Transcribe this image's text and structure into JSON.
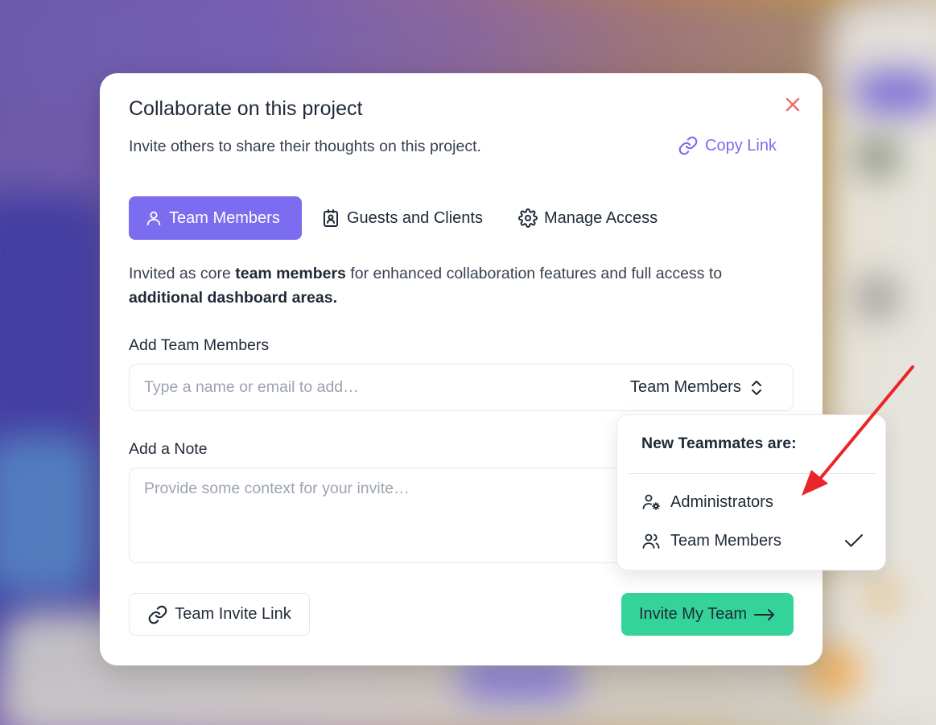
{
  "modal": {
    "title": "Collaborate on this project",
    "subtitle": "Invite others to share their thoughts on this project.",
    "copy_link_label": "Copy Link"
  },
  "tabs": [
    {
      "label": "Team Members",
      "icon": "user-icon",
      "active": true
    },
    {
      "label": "Guests and Clients",
      "icon": "contact-badge-icon",
      "active": false
    },
    {
      "label": "Manage Access",
      "icon": "gear-icon",
      "active": false
    }
  ],
  "description": {
    "part1": "Invited as core ",
    "bold1": "team members",
    "part2": " for enhanced collaboration features and full access to ",
    "bold2": "additional dashboard areas."
  },
  "add_members": {
    "label": "Add Team Members",
    "placeholder": "Type a name or email to add…",
    "role_value": "Team Members"
  },
  "note": {
    "label": "Add a Note",
    "placeholder": "Provide some context for your invite…"
  },
  "footer": {
    "invite_link_label": "Team Invite Link",
    "invite_button_label": "Invite My Team"
  },
  "role_dropdown": {
    "header": "New Teammates are:",
    "options": [
      {
        "label": "Administrators",
        "icon": "user-gear-icon",
        "selected": false
      },
      {
        "label": "Team Members",
        "icon": "users-icon",
        "selected": true
      }
    ]
  },
  "colors": {
    "accent": "#7c6cf0",
    "success": "#34d399",
    "close": "#ef6b6b",
    "annotation_arrow": "#e8262a"
  }
}
